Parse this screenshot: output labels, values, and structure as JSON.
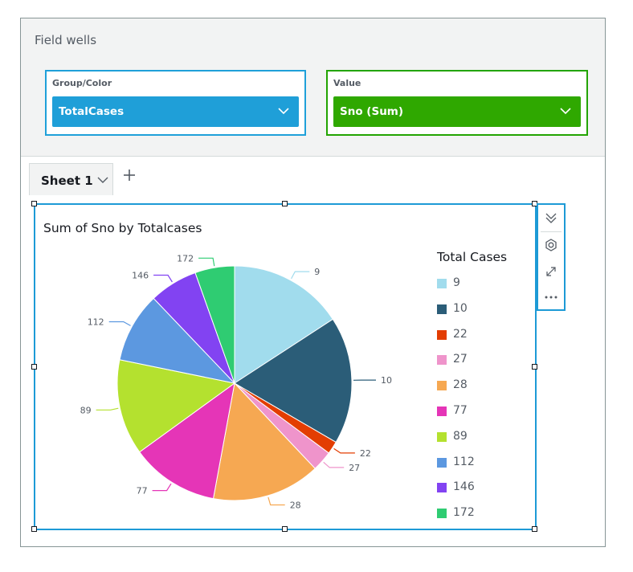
{
  "field_wells": {
    "title": "Field wells",
    "group_color": {
      "label": "Group/Color",
      "value": "TotalCases",
      "accent": "#1f9fd8"
    },
    "value": {
      "label": "Value",
      "value": "Sno (Sum)",
      "accent": "#2fa800"
    }
  },
  "sheets": {
    "tabs": [
      {
        "label": "Sheet 1"
      }
    ],
    "add_icon": "plus-icon"
  },
  "visual": {
    "title": "Sum of Sno by Totalcases",
    "menu_icons": [
      "collapse-chevrons-icon",
      "settings-gear-icon",
      "expand-icon",
      "more-options-icon"
    ]
  },
  "chart_data": {
    "type": "pie",
    "title": "Sum of Sno by Totalcases",
    "legend_title": "Total Cases",
    "legend_position": "right",
    "categories": [
      "9",
      "10",
      "22",
      "27",
      "28",
      "77",
      "89",
      "112",
      "146",
      "172"
    ],
    "values": [
      9,
      10,
      1,
      1.6,
      8.5,
      6.9,
      7.5,
      5.5,
      3.8,
      3.1
    ],
    "colors": [
      "#a1dced",
      "#2b5d78",
      "#e33d02",
      "#ef94cb",
      "#f6a852",
      "#e535b7",
      "#b4e12f",
      "#5c98e0",
      "#8243f2",
      "#2fcc72"
    ]
  }
}
